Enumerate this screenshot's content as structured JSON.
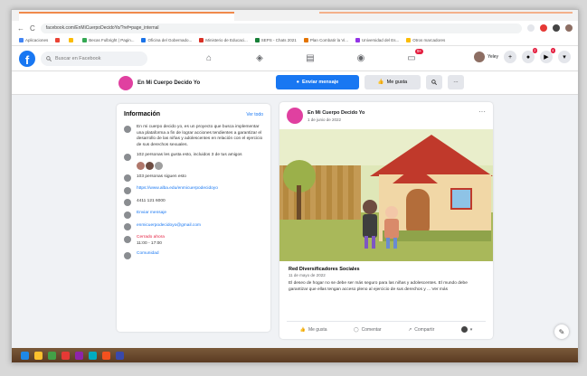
{
  "browser": {
    "url": "facebook.com/EnMiCuerpoDecidoYo/?ref=page_internal",
    "nav_back": "←",
    "nav_reload": "C",
    "bookmarks": [
      {
        "label": "Aplicaciones",
        "color": "#4285f4"
      },
      {
        "label": "",
        "color": "#ea4335"
      },
      {
        "label": "",
        "color": "#fbbc05"
      },
      {
        "label": "Becas Fulbright | Pagin...",
        "color": "#34a853"
      },
      {
        "label": "Oficina del Gobernado...",
        "color": "#1a73e8"
      },
      {
        "label": "Ministerio de Educaci...",
        "color": "#d93025"
      },
      {
        "label": "SEPS - Chats 2021",
        "color": "#188038"
      },
      {
        "label": "Plan Combatir la Vi...",
        "color": "#e37400"
      },
      {
        "label": "Universidad del Es...",
        "color": "#9334e6"
      },
      {
        "label": "Otros marcadores",
        "color": "#fbbc05"
      }
    ]
  },
  "facebook": {
    "logo": "f",
    "search_placeholder": "Buscar en Facebook",
    "nav_badge": "9+",
    "user_name": "Yeley",
    "messenger_badge": "2",
    "notif_badge": "4"
  },
  "page": {
    "name": "En Mi Cuerpo Decido Yo",
    "send_message": "Enviar mensaje",
    "like_button": "Me gusta"
  },
  "info": {
    "title": "Información",
    "see_all": "Ver todo",
    "description": "En mi cuerpo decido yo, es un proyecto que busca implementar una plataforma a fin de lograr acciones tendientes a garantizar el desarrollo de las niñas y adolescentes en relación con el ejercicio de sus derechos sexuales.",
    "friends_like": "102 personas les gusta esto, incluidos 3 de tus amigos",
    "followers": "103 personas siguen esto",
    "website": "https://www.alba.edu/enmicuerpodecidoyo",
    "phone": "4411 121 6000",
    "send_msg_link": "Enviar mensaje",
    "email": "enmicuerpodecidoyo@gmail.com",
    "status_closed": "Cerrado ahora",
    "hours": "11:00 - 17:00",
    "category": "Comunidad"
  },
  "post": {
    "author": "En Mi Cuerpo Decido Yo",
    "date": "1 de junio de 2022",
    "source_title": "Red Diversificadores Sociales",
    "source_date": "11 de mayo de 2022",
    "text": "El deseo de hogar no se debe ser más seguro para las niñas y adolescentes. El mundo debe garantizar que ellas tengan acceso pleno al ejercicio de sus derechos y ... Ver más",
    "like": "Me gusta",
    "comment": "Comentar",
    "share": "Compartir"
  }
}
